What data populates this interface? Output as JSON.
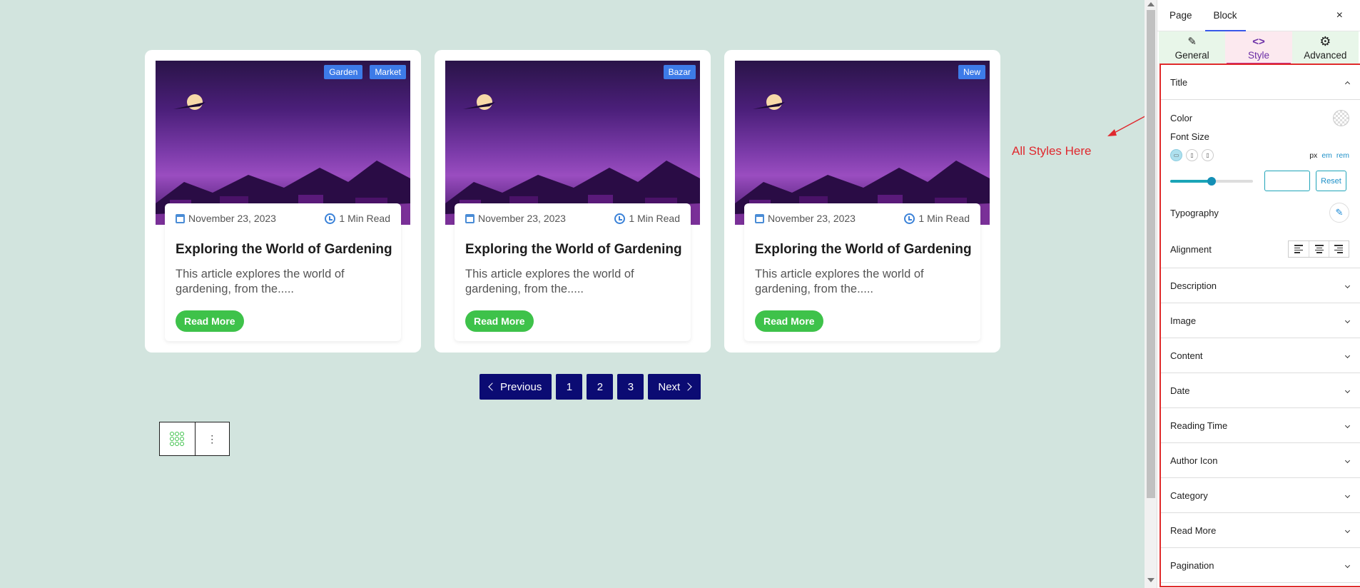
{
  "posts": [
    {
      "badges": [
        "Garden",
        "Market"
      ],
      "date": "November 23, 2023",
      "read_time": "1 Min Read",
      "title": "Exploring the World of Gardening",
      "excerpt": "This article explores the world of gardening, from the.....",
      "read_more": "Read More"
    },
    {
      "badges": [
        "Bazar"
      ],
      "date": "November 23, 2023",
      "read_time": "1 Min Read",
      "title": "Exploring the World of Gardening",
      "excerpt": "This article explores the world of gardening, from the.....",
      "read_more": "Read More"
    },
    {
      "badges": [
        "New"
      ],
      "date": "November 23, 2023",
      "read_time": "1 Min Read",
      "title": "Exploring the World of Gardening",
      "excerpt": "This article explores the world of gardening, from the.....",
      "read_more": "Read More"
    }
  ],
  "pagination": {
    "previous": "Previous",
    "pages": [
      "1",
      "2",
      "3"
    ],
    "next": "Next"
  },
  "annotation": {
    "text": "All Styles Here"
  },
  "sidebar": {
    "tabs": {
      "page": "Page",
      "block": "Block",
      "close": "×"
    },
    "subtabs": {
      "general": "General",
      "style": "Style",
      "advanced": "Advanced"
    },
    "title_section": {
      "heading": "Title",
      "color_label": "Color",
      "font_size_label": "Font Size",
      "units": [
        "px",
        "em",
        "rem"
      ],
      "font_size_value": "",
      "reset_label": "Reset",
      "typography_label": "Typography",
      "alignment_label": "Alignment"
    },
    "sections": [
      "Description",
      "Image",
      "Content",
      "Date",
      "Reading Time",
      "Author Icon",
      "Category",
      "Read More",
      "Pagination"
    ]
  },
  "colors": {
    "canvas_bg": "#d2e4de",
    "badge": "#3d7be8",
    "read_more_button": "#3ec24a",
    "pagination": "#0b0b73",
    "annotation": "#e0282e",
    "style_tab_bg": "#fce9ef",
    "slider": "#1aa5b7"
  },
  "icons": {
    "date": "calendar-icon",
    "read_time": "clock-icon",
    "general_tab": "pencil-icon",
    "style_tab": "code-brackets-icon",
    "advanced_tab": "gear-icon",
    "block_type": "grid-dots-icon",
    "block_options": "vertical-ellipsis-icon"
  }
}
